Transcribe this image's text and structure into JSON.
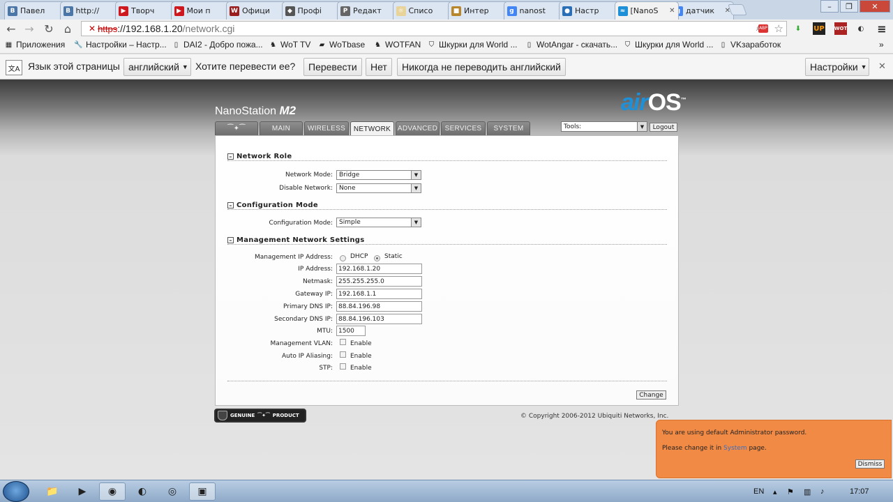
{
  "browser": {
    "tabs": [
      {
        "label": "Павел",
        "favicon": "vk-icon",
        "color": "#4a76a8",
        "letter": "В"
      },
      {
        "label": "http://",
        "favicon": "vk-icon",
        "color": "#4a76a8",
        "letter": "В"
      },
      {
        "label": "Творч",
        "favicon": "youtube-icon",
        "color": "#cc181e",
        "letter": "▶"
      },
      {
        "label": "Мои п",
        "favicon": "youtube-icon",
        "color": "#cc181e",
        "letter": "▶"
      },
      {
        "label": "Офици",
        "favicon": "wot-icon",
        "color": "#9b1c1c",
        "letter": "W"
      },
      {
        "label": "Профі",
        "favicon": "shield-icon",
        "color": "#555555",
        "letter": "◆"
      },
      {
        "label": "Редакт",
        "favicon": "edit-icon",
        "color": "#666666",
        "letter": "P"
      },
      {
        "label": "Списо",
        "favicon": "loading-icon",
        "color": "#e8d39a",
        "letter": "☼"
      },
      {
        "label": "Интер",
        "favicon": "folder-icon",
        "color": "#b8862b",
        "letter": "■"
      },
      {
        "label": "nanost",
        "favicon": "google-icon",
        "color": "#4285f4",
        "letter": "g"
      },
      {
        "label": "Настр",
        "favicon": "globe-icon",
        "color": "#2a6fb5",
        "letter": "●"
      },
      {
        "label": "[NanoS",
        "favicon": "wireless-icon",
        "color": "#1e90d8",
        "letter": "≈",
        "active": true
      },
      {
        "label": "датчик",
        "favicon": "google-icon",
        "color": "#4285f4",
        "letter": "g"
      }
    ],
    "url_scheme": "https",
    "url_host": "://192.168.1.20",
    "url_path": "/network.cgi",
    "bookmarks": [
      {
        "label": "Приложения",
        "icon": "apps-icon"
      },
      {
        "label": "Настройки – Настр...",
        "icon": "wrench-icon"
      },
      {
        "label": "DAI2 - Добро пожа...",
        "icon": "page-icon"
      },
      {
        "label": "WoT TV",
        "icon": "wot-icon"
      },
      {
        "label": "WoTbase",
        "icon": "tank-icon"
      },
      {
        "label": "WOTFAN",
        "icon": "wot-icon"
      },
      {
        "label": "Шкурки для World ...",
        "icon": "shield-icon"
      },
      {
        "label": "WotAngar - скачать...",
        "icon": "page-icon"
      },
      {
        "label": "Шкурки для World ...",
        "icon": "shield-icon"
      },
      {
        "label": "VKзаработок",
        "icon": "page-icon"
      }
    ],
    "translate": {
      "page_lang_label": "Язык этой страницы",
      "lang_value": "английский",
      "question": "Хотите перевести ее?",
      "translate_btn": "Перевести",
      "no_btn": "Нет",
      "never_btn": "Никогда не переводить английский",
      "settings_btn": "Настройки"
    }
  },
  "device": {
    "model": "NanoStation",
    "model_suffix": "M2",
    "logo_air": "air",
    "logo_os": "OS",
    "logo_tm": "™",
    "nav": [
      "MAIN",
      "WIRELESS",
      "NETWORK",
      "ADVANCED",
      "SERVICES",
      "SYSTEM"
    ],
    "active_nav": "NETWORK",
    "tools_label": "Tools:",
    "logout": "Logout"
  },
  "form": {
    "network_role": {
      "title": "Network Role",
      "network_mode_label": "Network Mode:",
      "network_mode": "Bridge",
      "disable_network_label": "Disable Network:",
      "disable_network": "None"
    },
    "configuration_mode": {
      "title": "Configuration Mode",
      "label": "Configuration Mode:",
      "value": "Simple"
    },
    "management": {
      "title": "Management Network Settings",
      "mgmt_ip_label": "Management IP Address:",
      "dhcp": "DHCP",
      "static": "Static",
      "selected": "Static",
      "ip_label": "IP Address:",
      "ip": "192.168.1.20",
      "netmask_label": "Netmask:",
      "netmask": "255.255.255.0",
      "gateway_label": "Gateway IP:",
      "gateway": "192.168.1.1",
      "dns1_label": "Primary DNS IP:",
      "dns1": "88.84.196.98",
      "dns2_label": "Secondary DNS IP:",
      "dns2": "88.84.196.103",
      "mtu_label": "MTU:",
      "mtu": "1500",
      "vlan_label": "Management VLAN:",
      "alias_label": "Auto IP Aliasing:",
      "stp_label": "STP:",
      "enable": "Enable"
    },
    "change_btn": "Change"
  },
  "footer": {
    "genuine": "GENUINE",
    "product": "PRODUCT",
    "copyright": "© Copyright 2006-2012 Ubiquiti Networks, Inc."
  },
  "notice": {
    "line1": "You are using default Administrator password.",
    "line2_pre": "Please change it in",
    "line2_link": "System",
    "line2_post": "page.",
    "dismiss": "Dismiss"
  },
  "taskbar": {
    "lang": "EN",
    "time": "17:07"
  }
}
